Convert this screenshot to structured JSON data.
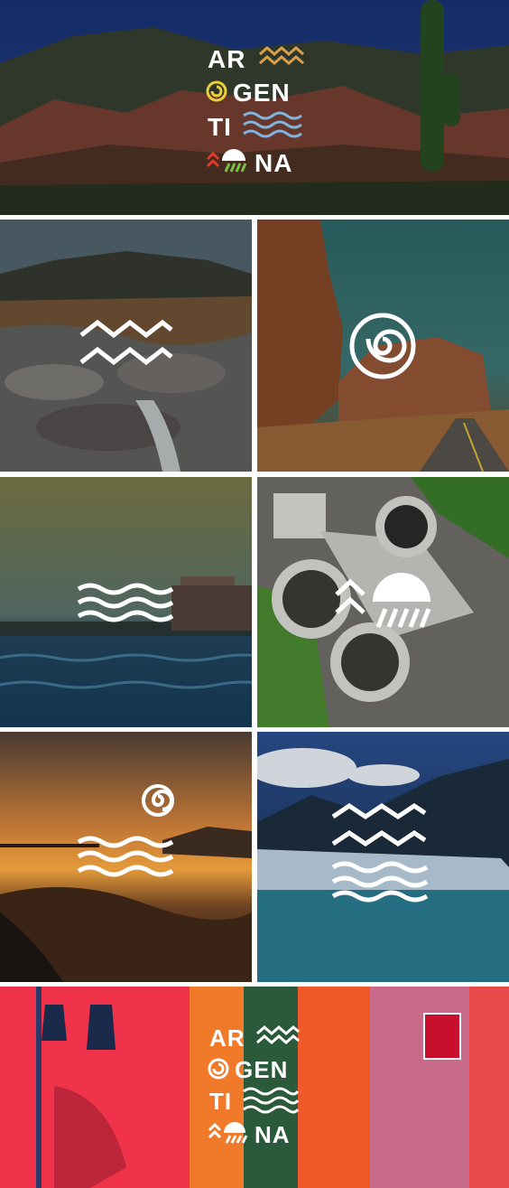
{
  "logo": {
    "line1": "AR",
    "line2": "GEN",
    "line3": "TI",
    "line4": "NA"
  },
  "colors": {
    "zigzag": "#d9a04a",
    "spiral": "#e8d23a",
    "waves": "#7fb3e0",
    "arrow": "#e23b2e",
    "sun": "#ffffff",
    "stripes": "#7ac143",
    "symbol": "#ffffff",
    "divider": "#ffffff"
  },
  "panels": [
    {
      "scene": "mountains-cactus",
      "symbols": [
        "logo"
      ]
    },
    {
      "scene": "rocky-river",
      "symbols": [
        "zigzag-icon"
      ]
    },
    {
      "scene": "canyon-road",
      "symbols": [
        "spiral-icon"
      ]
    },
    {
      "scene": "sea-pier",
      "symbols": [
        "waves-icon"
      ]
    },
    {
      "scene": "water-treatment-plant",
      "symbols": [
        "arrow-icon",
        "sun-stripes-icon"
      ]
    },
    {
      "scene": "beach-sunset",
      "symbols": [
        "spiral-icon",
        "waves-icon"
      ]
    },
    {
      "scene": "glacier",
      "symbols": [
        "zigzag-icon",
        "waves-icon"
      ]
    },
    {
      "scene": "colorful-street",
      "symbols": [
        "logo"
      ]
    }
  ]
}
